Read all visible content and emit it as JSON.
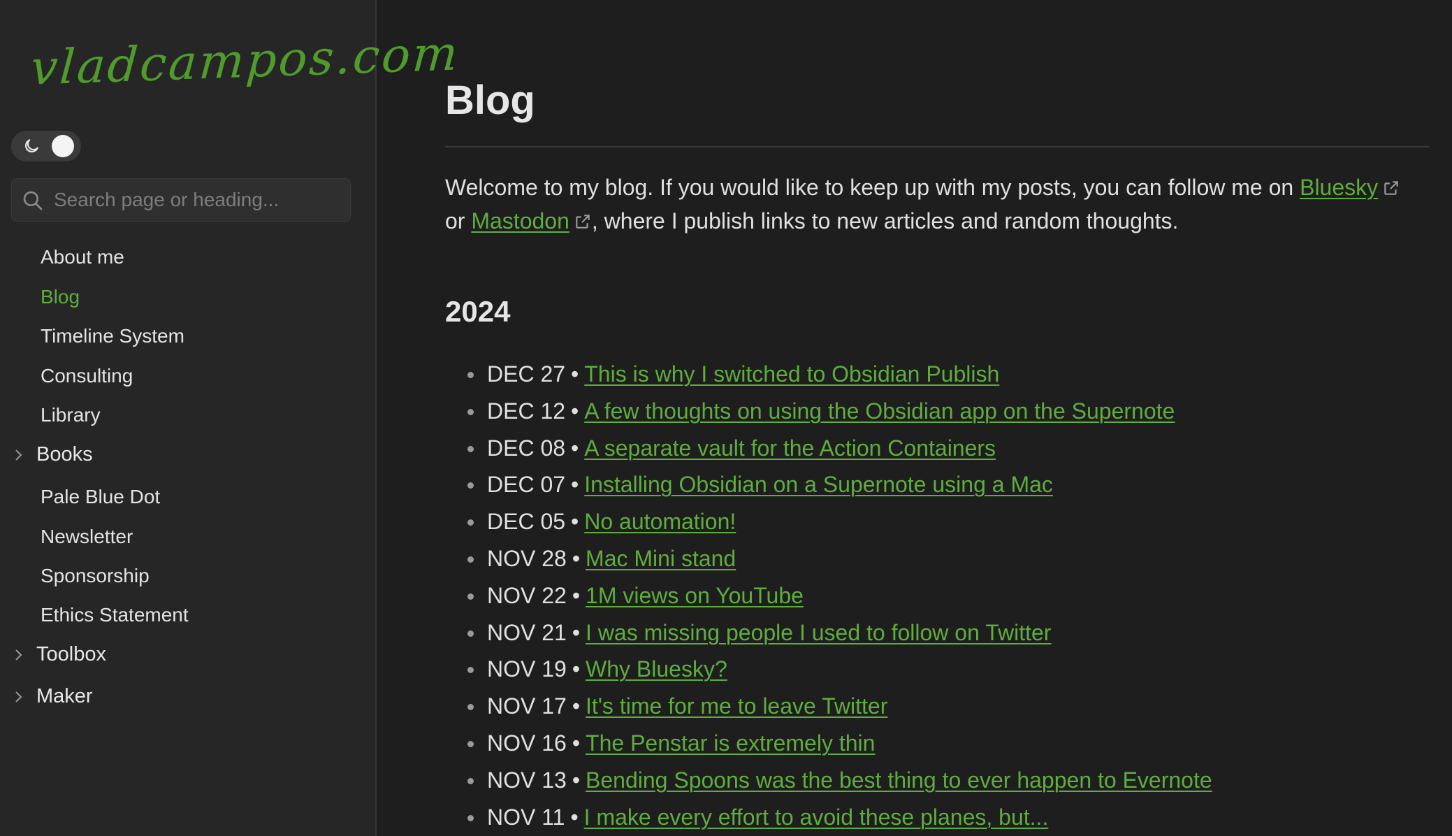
{
  "site": {
    "logo_text": "vladcampos.com"
  },
  "search": {
    "placeholder": "Search page or heading..."
  },
  "sidebar": {
    "items": [
      {
        "label": "About me"
      },
      {
        "label": "Blog",
        "active": true
      },
      {
        "label": "Timeline System"
      },
      {
        "label": "Consulting"
      },
      {
        "label": "Library"
      },
      {
        "label": "Books",
        "folder": true
      },
      {
        "label": "Pale Blue Dot"
      },
      {
        "label": "Newsletter"
      },
      {
        "label": "Sponsorship"
      },
      {
        "label": "Ethics Statement"
      },
      {
        "label": "Toolbox",
        "folder": true
      },
      {
        "label": "Maker",
        "folder": true
      }
    ]
  },
  "main": {
    "title": "Blog",
    "intro": {
      "text1": "Welcome to my blog. If you would like to keep up with my posts, you can follow me on ",
      "link1": "Bluesky",
      "text2": "or ",
      "link2": "Mastodon",
      "text3": ", where I publish links to new articles and random thoughts."
    },
    "year": "2024",
    "separator": "•",
    "posts": [
      {
        "date": "DEC 27",
        "title": "This is why I switched to Obsidian Publish"
      },
      {
        "date": "DEC 12",
        "title": "A few thoughts on using the Obsidian app on the Supernote"
      },
      {
        "date": "DEC 08",
        "title": "A separate vault for the Action Containers"
      },
      {
        "date": "DEC 07",
        "title": "Installing Obsidian on a Supernote using a Mac"
      },
      {
        "date": "DEC 05",
        "title": "No automation!"
      },
      {
        "date": "NOV 28",
        "title": "Mac Mini stand"
      },
      {
        "date": "NOV 22",
        "title": "1M views on YouTube"
      },
      {
        "date": "NOV 21",
        "title": "I was missing people I used to follow on Twitter"
      },
      {
        "date": "NOV 19",
        "title": "Why Bluesky?"
      },
      {
        "date": "NOV 17",
        "title": "It's time for me to leave Twitter"
      },
      {
        "date": "NOV 16",
        "title": "The Penstar is extremely thin"
      },
      {
        "date": "NOV 13",
        "title": "Bending Spoons was the best thing to ever happen to Evernote"
      },
      {
        "date": "NOV 11",
        "title": "I make every effort to avoid these planes, but..."
      }
    ]
  },
  "colors": {
    "background": "#1e1e1e",
    "sidebar": "#262626",
    "accent": "#5fae3d",
    "logo": "#4f9b2c"
  }
}
